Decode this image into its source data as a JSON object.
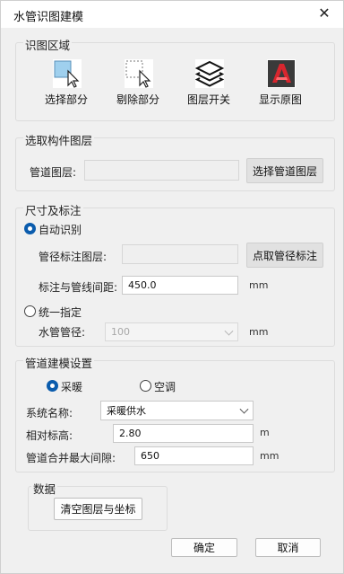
{
  "window": {
    "title": "水管识图建模",
    "close_glyph": "✕"
  },
  "region": {
    "title": "识图区域",
    "tools": [
      {
        "label": "选择部分",
        "icon": "select-region-icon"
      },
      {
        "label": "剔除部分",
        "icon": "exclude-region-icon"
      },
      {
        "label": "图层开关",
        "icon": "layers-icon"
      },
      {
        "label": "显示原图",
        "icon": "show-original-icon"
      }
    ]
  },
  "layer_select": {
    "title": "选取构件图层",
    "pipe_layer_label": "管道图层:",
    "pipe_layer_value": "",
    "pick_button": "选择管道图层"
  },
  "dimension": {
    "title": "尺寸及标注",
    "auto_label": "自动识别",
    "annot_layer_label": "管径标注图层:",
    "annot_layer_value": "",
    "pick_annot_button": "点取管径标注",
    "distance_label": "标注与管线间距:",
    "distance_value": "450.0",
    "distance_unit": "mm",
    "uniform_label": "统一指定",
    "diameter_label": "水管管径:",
    "diameter_value": "100",
    "diameter_unit": "mm"
  },
  "model": {
    "title": "管道建模设置",
    "heating_label": "采暖",
    "ac_label": "空调",
    "system_label": "系统名称:",
    "system_value": "采暖供水",
    "elevation_label": "相对标高:",
    "elevation_value": "2.80",
    "elevation_unit": "m",
    "gap_label": "管道合并最大间隙:",
    "gap_value": "650",
    "gap_unit": "mm"
  },
  "data": {
    "title": "数据",
    "clear_button": "清空图层与坐标"
  },
  "footer": {
    "ok": "确定",
    "cancel": "取消"
  },
  "colors": {
    "accent": "#0b5cad",
    "logo_red": "#d8262e"
  }
}
